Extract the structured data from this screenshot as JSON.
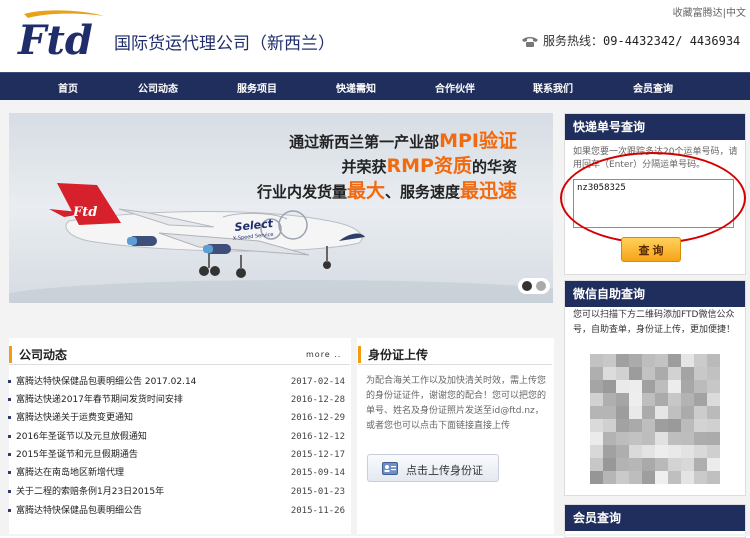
{
  "header": {
    "logo_text": "Ftd",
    "company_name": "国际货运代理公司（新西兰）",
    "top_links": [
      "收藏富腾达",
      "中文"
    ],
    "top_separator": "|",
    "hotline_label": "服务热线：",
    "hotline_numbers": "09-4432342/ 4436934"
  },
  "nav": {
    "items": [
      "首页",
      "公司动态",
      "服务项目",
      "快递需知",
      "合作伙伴",
      "联系我们",
      "会员查询"
    ]
  },
  "banner": {
    "line1_a": "通过新西兰第一产业部",
    "line1_b": "MPI验证",
    "line2_a": "并荣获",
    "line2_b": "RMP资质",
    "line2_c": "的华资",
    "line3_a": "行业内发货量",
    "line3_b": "最大",
    "line3_c": "、服务速度",
    "line3_d": "最迅速",
    "plane_tail_text": "Ftd",
    "plane_fuselage_text": "Select",
    "plane_fuselage_sub": "X-Speed Service"
  },
  "news": {
    "title": "公司动态",
    "more": "more ..",
    "items": [
      {
        "title": "富腾达特快保健品包裹明细公告 2017.02.14",
        "date": "2017-02-14"
      },
      {
        "title": "富腾达快递2017年春节期间发货时间安排",
        "date": "2016-12-28"
      },
      {
        "title": "富腾达快递关于运费变更通知",
        "date": "2016-12-29"
      },
      {
        "title": "2016年圣诞节以及元旦放假通知",
        "date": "2016-12-12"
      },
      {
        "title": "2015年圣诞节和元旦假期通告",
        "date": "2015-12-17"
      },
      {
        "title": "富腾达在南岛地区新增代理",
        "date": "2015-09-14"
      },
      {
        "title": "关于二程的索赔条例1月23日2015年",
        "date": "2015-01-23"
      },
      {
        "title": "富腾达特快保健品包裹明细公告",
        "date": "2015-11-26"
      }
    ]
  },
  "idcard": {
    "title": "身份证上传",
    "text": "为配合海关工作以及加快清关时效，需上传您的身份证证件，谢谢您的配合！您可以把您的单号、姓名及身份证照片发送至id@ftd.nz，或者您也可以点击下面链接直接上传",
    "button": "点击上传身份证"
  },
  "tracking": {
    "title": "快递单号查询",
    "hint": "如果您要一次跟踪多达20个运单号码，请用回车（Enter）分隔运单号码。",
    "value": "nz3058325",
    "button": "查 询"
  },
  "wechat": {
    "title": "微信自助查询",
    "text": "您可以扫描下方二维码添加FTD微信公众号，自助查单，身份证上传，更加便捷！"
  },
  "member": {
    "title": "会员查询"
  },
  "colors": {
    "navy": "#1f2e5c",
    "accent_orange": "#f26a10",
    "section_bar": "#f39c12",
    "annotation_red": "#d40000"
  }
}
